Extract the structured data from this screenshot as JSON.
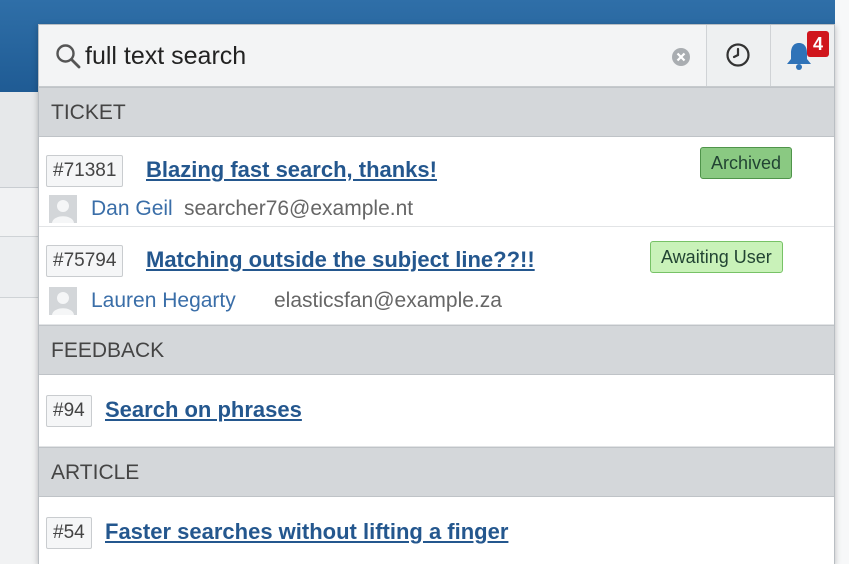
{
  "search": {
    "value": "full text search",
    "placeholder": ""
  },
  "notifications": {
    "count": "4"
  },
  "sections": [
    {
      "header": "TICKET",
      "results": [
        {
          "id": "#71381",
          "title": "Blazing fast search, thanks!",
          "status": "Archived",
          "person_name": "Dan Geil",
          "person_email": "searcher76@example.nt"
        },
        {
          "id": "#75794",
          "title": "Matching outside the subject line??!!",
          "status": "Awaiting User",
          "person_name": "Lauren Hegarty",
          "person_email": "elasticsfan@example.za"
        }
      ]
    },
    {
      "header": "FEEDBACK",
      "results": [
        {
          "id": "#94",
          "title": "Search on phrases"
        }
      ]
    },
    {
      "header": "ARTICLE",
      "results": [
        {
          "id": "#54",
          "title": "Faster searches without lifting a finger"
        }
      ]
    }
  ],
  "colors": {
    "topbar": "#1f5b94",
    "link": "#24578e",
    "archived": "#8ac982",
    "awaiting": "#c9f2b9",
    "badge": "#d0161d"
  },
  "icons": {
    "search": "search-icon",
    "clear": "clear-icon",
    "history": "clock-icon",
    "notifications": "bell-icon",
    "avatar": "user-avatar-icon"
  }
}
